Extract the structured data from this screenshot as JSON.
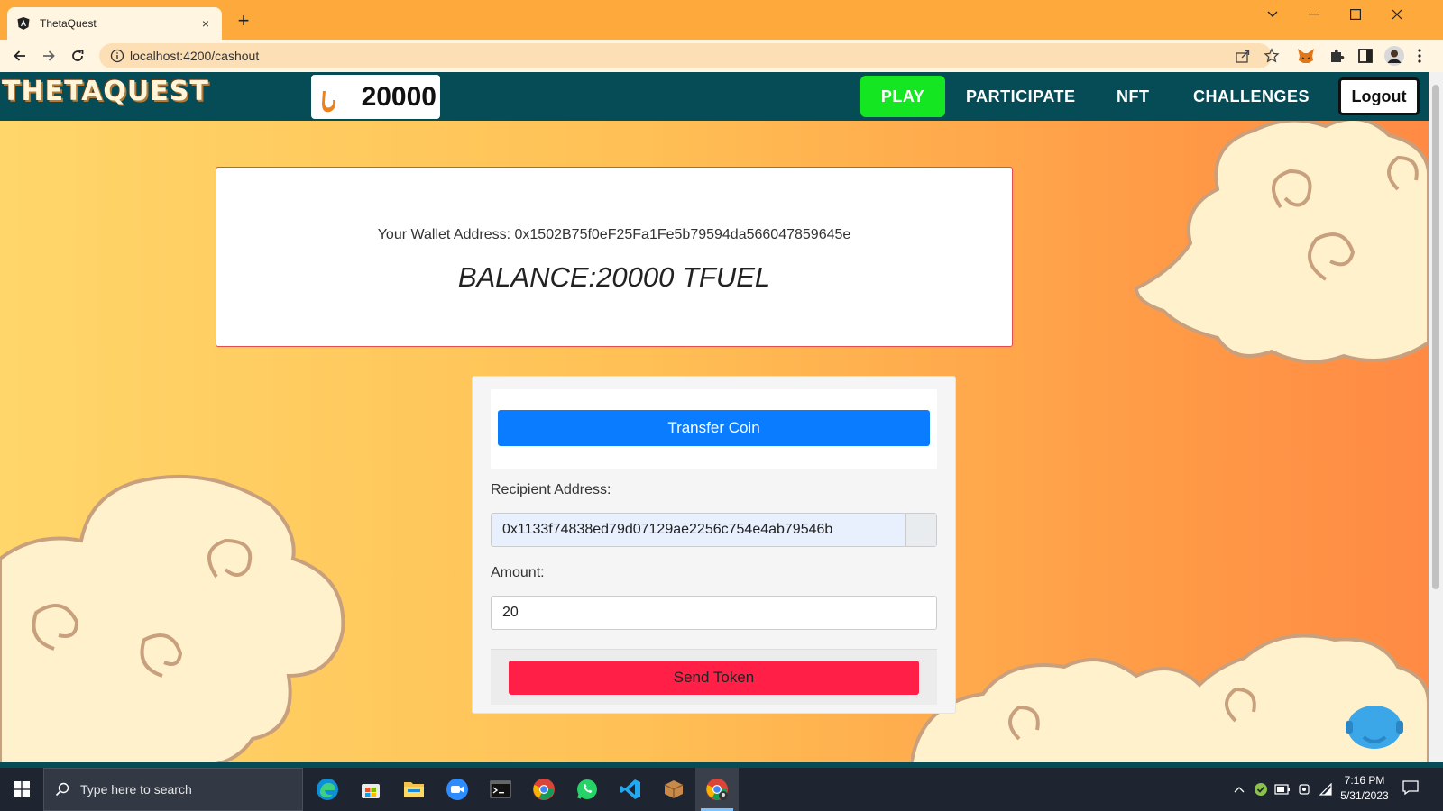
{
  "browser": {
    "tab_title": "ThetaQuest",
    "tab_close": "×",
    "new_tab": "+",
    "url": "localhost:4200/cashout"
  },
  "navbar": {
    "logo": "THETAQUEST",
    "coin_balance": "20000",
    "links": {
      "play": "PLAY",
      "participate": "PARTICIPATE",
      "nft": "NFT",
      "challenges": "CHALLENGES"
    },
    "logout": "Logout",
    "colors": {
      "bar": "#054c56",
      "play": "#14e621"
    }
  },
  "wallet": {
    "address_label": "Your Wallet Address: 0x1502B75f0eF25Fa1Fe5b79594da566047859645e",
    "balance": "BALANCE:20000 TFUEL"
  },
  "transfer_form": {
    "transfer_button": "Transfer Coin",
    "recipient_label": "Recipient Address:",
    "recipient_value": "0x1133f74838ed79d07129ae2256c754e4ab79546b",
    "amount_label": "Amount:",
    "amount_value": "20",
    "send_button": "Send Token",
    "colors": {
      "transfer": "#0a7cff",
      "send": "#ff1f47"
    }
  },
  "taskbar": {
    "search_placeholder": "Type here to search",
    "time": "7:16 PM",
    "date": "5/31/2023",
    "apps": [
      "edge-icon",
      "store-icon",
      "file-explorer-icon",
      "zoom-icon",
      "terminal-icon",
      "chrome-icon",
      "whatsapp-icon",
      "vscode-icon",
      "package-icon",
      "chrome-profile-icon"
    ]
  }
}
